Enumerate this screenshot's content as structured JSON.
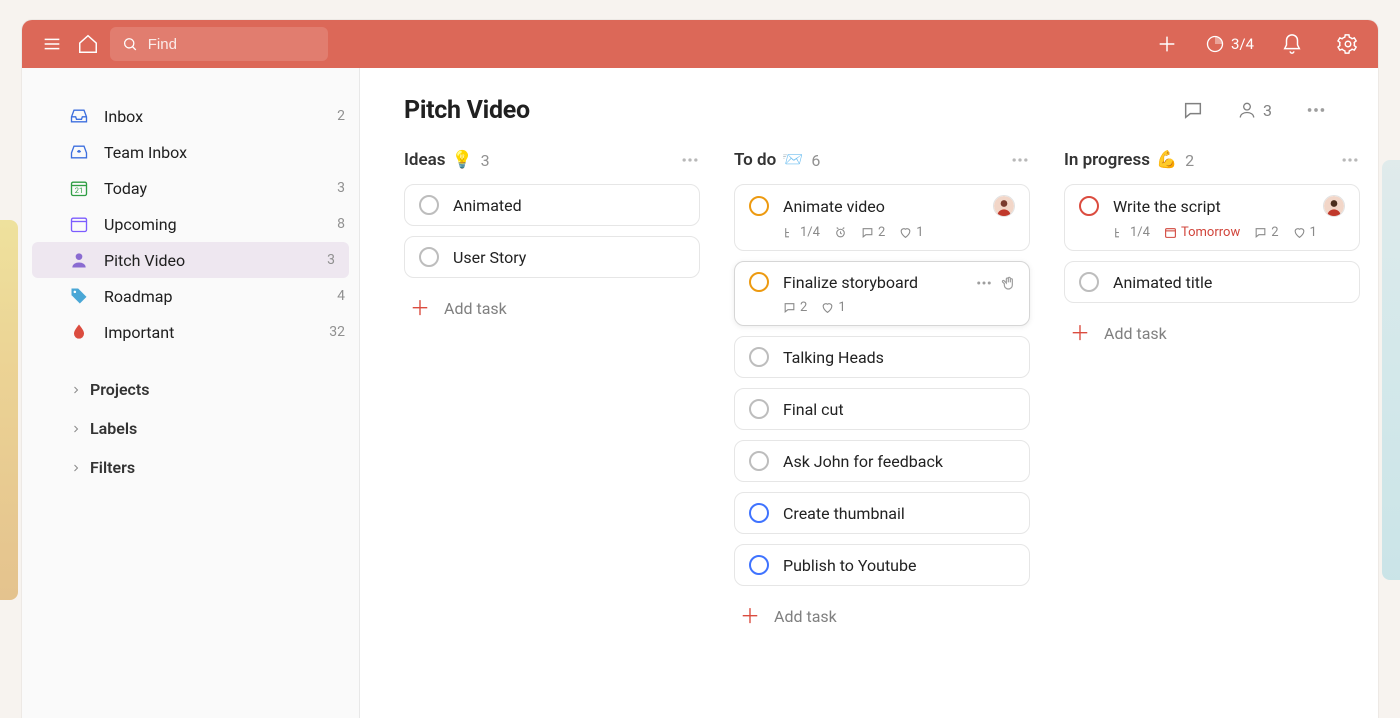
{
  "header": {
    "search_placeholder": "Find",
    "progress": "3/4"
  },
  "sidebar": {
    "items": [
      {
        "id": "inbox",
        "label": "Inbox",
        "count": "2"
      },
      {
        "id": "team-inbox",
        "label": "Team Inbox",
        "count": ""
      },
      {
        "id": "today",
        "label": "Today",
        "count": "3"
      },
      {
        "id": "upcoming",
        "label": "Upcoming",
        "count": "8"
      },
      {
        "id": "pitch",
        "label": "Pitch Video",
        "count": "3"
      },
      {
        "id": "roadmap",
        "label": "Roadmap",
        "count": "4"
      },
      {
        "id": "important",
        "label": "Important",
        "count": "32"
      }
    ],
    "sections": {
      "projects": "Projects",
      "labels": "Labels",
      "filters": "Filters"
    }
  },
  "project": {
    "title": "Pitch Video",
    "people_count": "3"
  },
  "columns": [
    {
      "title": "Ideas",
      "emoji": "💡",
      "count": "3",
      "add_label": "Add task",
      "cards": [
        {
          "title": "Animated",
          "variant": "plain"
        },
        {
          "title": "User Story",
          "variant": "plain"
        }
      ]
    },
    {
      "title": "To do",
      "emoji": "📨",
      "count": "6",
      "add_label": "Add task",
      "cards": [
        {
          "title": "Animate video",
          "variant": "orange",
          "avatar": true,
          "meta": {
            "subtasks": "1/4",
            "reminder": true,
            "comments": "2",
            "likes": "1"
          }
        },
        {
          "title": "Finalize storyboard",
          "variant": "orange",
          "hover": true,
          "meta": {
            "comments": "2",
            "likes": "1"
          }
        },
        {
          "title": "Talking Heads",
          "variant": "plain"
        },
        {
          "title": "Final cut",
          "variant": "plain"
        },
        {
          "title": "Ask John for feedback",
          "variant": "plain"
        },
        {
          "title": "Create thumbnail",
          "variant": "blue"
        },
        {
          "title": "Publish to Youtube",
          "variant": "blue"
        }
      ]
    },
    {
      "title": "In progress",
      "emoji": "💪",
      "count": "2",
      "add_label": "Add task",
      "cards": [
        {
          "title": "Write the script",
          "variant": "red",
          "avatar": true,
          "meta": {
            "subtasks": "1/4",
            "due": "Tomorrow",
            "comments": "2",
            "likes": "1"
          }
        },
        {
          "title": "Animated title",
          "variant": "plain"
        }
      ]
    }
  ]
}
